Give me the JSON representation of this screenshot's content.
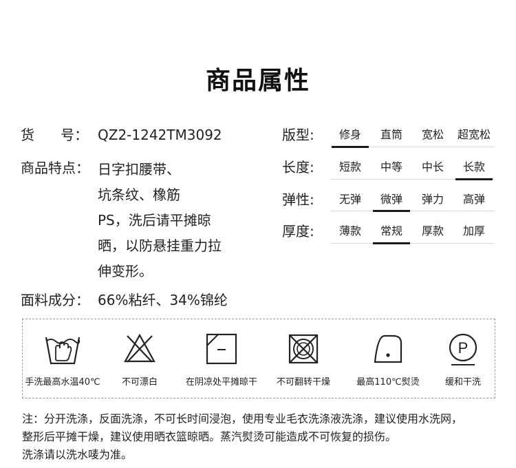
{
  "title": "商品属性",
  "spec": {
    "item_no_label": "货      号：",
    "item_no_value": "QZ2-1242TM3092",
    "features_label": "商品特点：",
    "features_lines": [
      "日字扣腰带、",
      "坑条纹、橡筋",
      "PS，洗后请平摊晾",
      "晒，以防悬挂重力拉",
      "伸变形。"
    ],
    "material_label": "面料成分：",
    "material_value": "66%粘纤、34%锦纶"
  },
  "attributes": [
    {
      "label": "版型:",
      "options": [
        "修身",
        "直筒",
        "宽松",
        "超宽松"
      ],
      "selected": 0
    },
    {
      "label": "长度:",
      "options": [
        "短款",
        "中等",
        "中长",
        "长款"
      ],
      "selected": 3
    },
    {
      "label": "弹性:",
      "options": [
        "无弹",
        "微弹",
        "弹力",
        "高弹"
      ],
      "selected": 1
    },
    {
      "label": "厚度:",
      "options": [
        "薄款",
        "常规",
        "厚款",
        "加厚"
      ],
      "selected": 1
    }
  ],
  "care": [
    {
      "icon": "hand-wash-icon",
      "label": "手洗最高水温40℃"
    },
    {
      "icon": "no-bleach-icon",
      "label": "不可漂白"
    },
    {
      "icon": "shade-flat-dry-icon",
      "label": "在阴凉处平摊晾干"
    },
    {
      "icon": "no-tumble-dry-icon",
      "label": "不可翻转干燥"
    },
    {
      "icon": "iron-110-icon",
      "label": "最高110℃熨烫"
    },
    {
      "icon": "gentle-dry-clean-icon",
      "label": "缓和干洗"
    }
  ],
  "note_lines": [
    "注：分开洗涤，反面洗涤，不可长时间浸泡，使用专业毛衣洗涤液洗涤，建议使用水洗网，",
    "整形后平摊干燥，建议使用晒衣篮晾晒。蒸汽熨烫可能造成不可恢复的损伤。",
    "洗涤请以洗水唛为准。"
  ]
}
